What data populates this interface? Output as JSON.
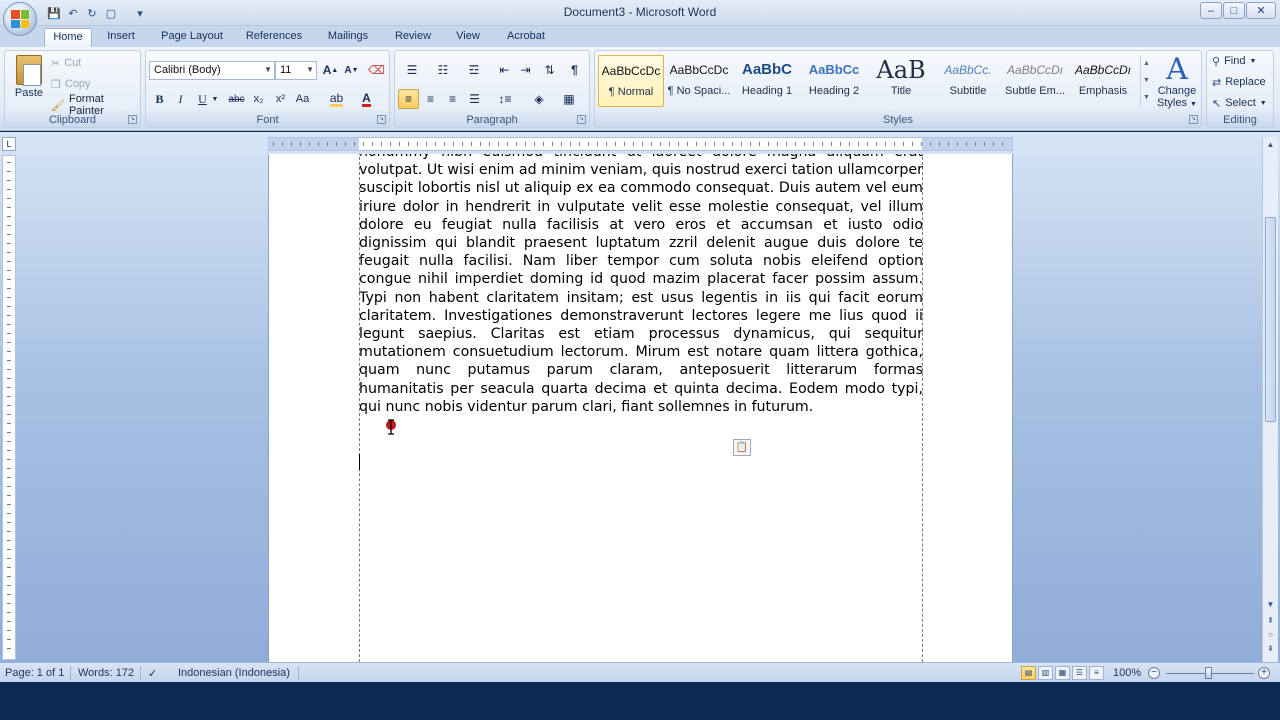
{
  "window": {
    "title": "Document3 - Microsoft Word",
    "minimize": "–",
    "maximize": "□",
    "close": "✕"
  },
  "qat": {
    "save": "💾",
    "undo": "↶",
    "redo": "↻",
    "new": "▢",
    "more": "▾"
  },
  "tabs": [
    "Home",
    "Insert",
    "Page Layout",
    "References",
    "Mailings",
    "Review",
    "View",
    "Acrobat"
  ],
  "clipboard": {
    "label": "Clipboard",
    "paste": "Paste",
    "cut": "Cut",
    "copy": "Copy",
    "format_painter": "Format Painter"
  },
  "font": {
    "label": "Font",
    "name": "Calibri (Body)",
    "size": "11",
    "grow": "A",
    "shrink": "A",
    "bold": "B",
    "italic": "I",
    "underline": "U",
    "strike": "abc",
    "subscript": "x₂",
    "superscript": "x²",
    "case": "Aa"
  },
  "paragraph": {
    "label": "Paragraph",
    "pilcrow": "¶"
  },
  "styles": {
    "label": "Styles",
    "items": [
      {
        "sample": "AaBbCcDc",
        "name": "¶ Normal"
      },
      {
        "sample": "AaBbCcDc",
        "name": "¶ No Spaci..."
      },
      {
        "sample": "AaBbC",
        "name": "Heading 1"
      },
      {
        "sample": "AaBbCc",
        "name": "Heading 2"
      },
      {
        "sample": "AaB",
        "name": "Title"
      },
      {
        "sample": "AaBbCc.",
        "name": "Subtitle"
      },
      {
        "sample": "AaBbCcDı",
        "name": "Subtle Em..."
      },
      {
        "sample": "AaBbCcDı",
        "name": "Emphasis"
      }
    ],
    "change_styles_1": "Change",
    "change_styles_2": "Styles",
    "big_a": "A"
  },
  "editing": {
    "label": "Editing",
    "find": "Find",
    "replace": "Replace",
    "select": "Select"
  },
  "ruler_corner": "L",
  "document": {
    "text": "nonummy nibh euismod tincidunt ut laoreet dolore magna aliquam erat volutpat. Ut wisi enim ad minim veniam, quis nostrud exerci tation ullamcorper suscipit lobortis nisl ut aliquip ex ea commodo consequat. Duis autem vel eum iriure dolor in hendrerit in vulputate velit esse molestie consequat, vel illum dolore eu feugiat nulla facilisis at vero eros et accumsan et iusto odio dignissim qui blandit praesent luptatum zzril delenit augue duis dolore te feugait nulla facilisi. Nam liber tempor cum soluta nobis eleifend option congue nihil imperdiet doming id quod mazim placerat facer possim assum. Typi non habent claritatem insitam; est usus legentis in iis qui facit eorum claritatem. Investigationes demonstraverunt lectores legere me lius quod ii legunt saepius. Claritas est etiam processus dynamicus, qui sequitur mutationem consuetudium lectorum. Mirum est notare quam littera gothica, quam nunc putamus parum claram, anteposuerit litterarum formas humanitatis per seacula quarta decima et quinta decima. Eodem modo typi, qui nunc nobis videntur parum clari, fiant sollemnes in futurum."
  },
  "status": {
    "page": "Page: 1 of 1",
    "words": "Words: 172",
    "language": "Indonesian (Indonesia)",
    "zoom": "100%"
  },
  "colors": {
    "ribbon": "#e3ebf6",
    "highlight": "#ffcc5a",
    "font_color": "#d22020",
    "workspace": "#a9c2e3"
  }
}
